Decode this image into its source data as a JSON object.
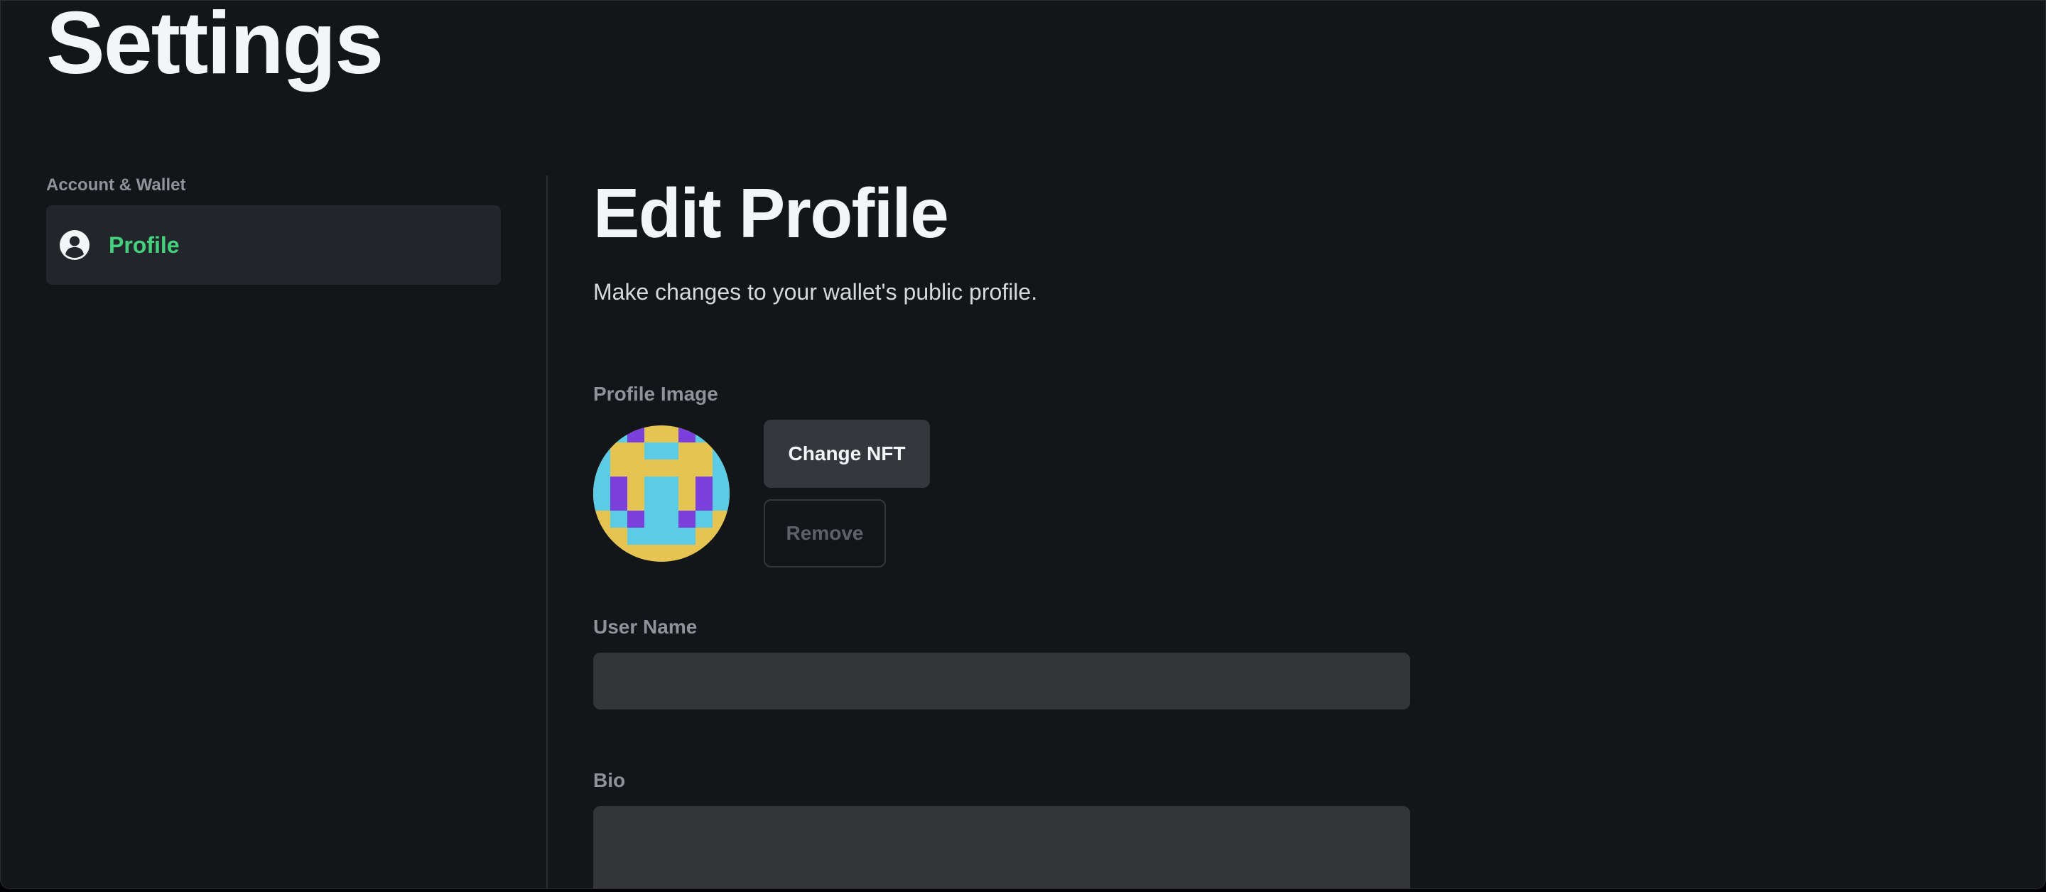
{
  "page": {
    "title": "Settings"
  },
  "sidebar": {
    "section_label": "Account & Wallet",
    "items": [
      {
        "label": "Profile",
        "icon": "user-circle-icon",
        "active": true
      }
    ]
  },
  "main": {
    "heading": "Edit Profile",
    "subtitle": "Make changes to your wallet's public profile.",
    "profile_image": {
      "label": "Profile Image",
      "change_label": "Change NFT",
      "remove_label": "Remove"
    },
    "user_name": {
      "label": "User Name",
      "value": ""
    },
    "bio": {
      "label": "Bio",
      "value": ""
    }
  },
  "colors": {
    "background": "#131619",
    "accent": "#44d07c",
    "avatar_yellow": "#e5c451",
    "avatar_cyan": "#5ccbe6",
    "avatar_purple": "#7b3fdc"
  }
}
